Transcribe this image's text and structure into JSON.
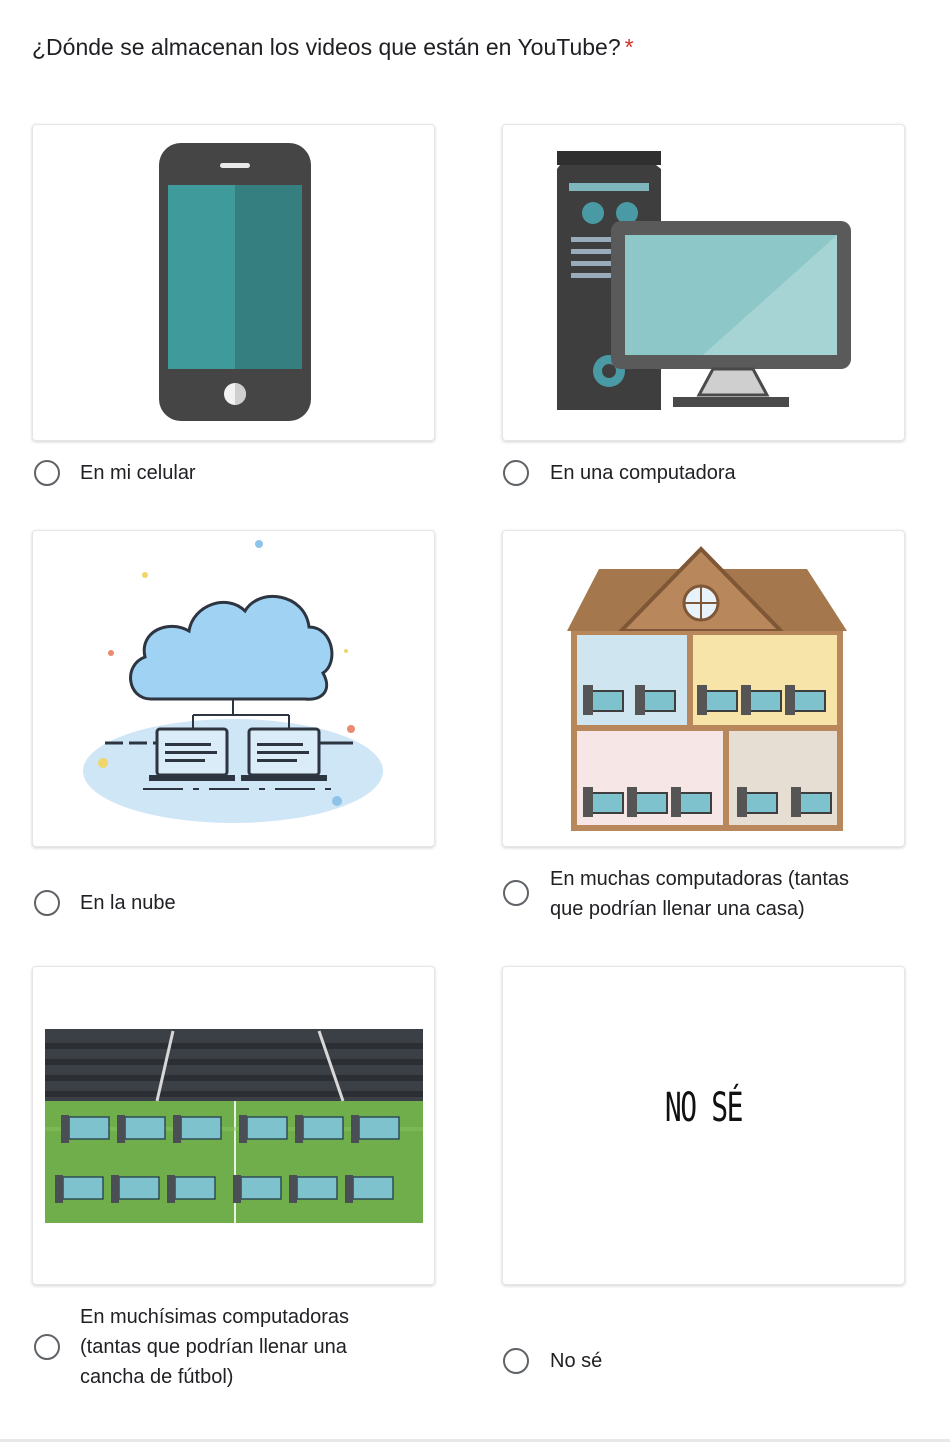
{
  "question": {
    "title": "¿Dónde se almacenan los videos que están en YouTube?",
    "required_mark": "*"
  },
  "options": [
    {
      "label": "En mi celular",
      "image": "smartphone-illustration"
    },
    {
      "label": "En una computadora",
      "image": "desktop-computer-illustration"
    },
    {
      "label": "En la nube",
      "image": "cloud-network-illustration"
    },
    {
      "label_line1": "En muchas computadoras (tantas",
      "label_line2": "que podrían llenar una casa)",
      "image": "house-full-of-computers-illustration"
    },
    {
      "label_line1": "En muchísimas computadoras",
      "label_line2": "(tantas que podrían llenar una",
      "label_line3": "cancha de fútbol)",
      "image": "stadium-full-of-computers-illustration"
    },
    {
      "label": "No sé",
      "image_text": "NO SÉ"
    }
  ],
  "colors": {
    "required": "#d93025",
    "radio_border": "#5f6368",
    "text": "#202124"
  }
}
